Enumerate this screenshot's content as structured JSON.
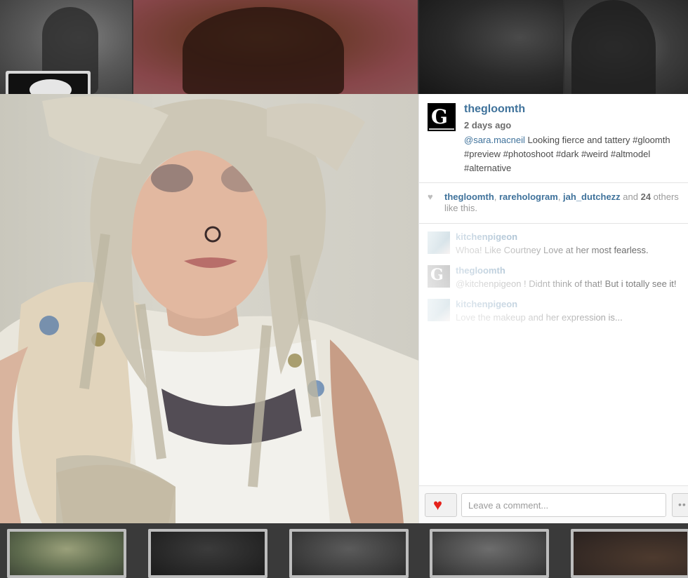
{
  "post": {
    "username": "thegloomth",
    "time_ago": "2 days ago",
    "caption_mention": "@sara.macneil",
    "caption_text": " Looking fierce and tattery #gloomth #preview #photoshoot #dark #weird #altmodel #alternative",
    "likes": {
      "users": [
        "thegloomth",
        "rarehologram",
        "jah_dutchezz"
      ],
      "and_text": " and ",
      "count": "24",
      "others_text": " others like this."
    }
  },
  "comments": [
    {
      "user": "kitchenpigeon",
      "text": "Whoa! Like Courtney Love at her most fearless."
    },
    {
      "user": "thegloomth",
      "text": "@kitchenpigeon ! Didnt think of that! But i totally see it!"
    },
    {
      "user": "kitchenpigeon",
      "text": "Love the makeup and her expression is..."
    }
  ],
  "footer": {
    "comment_placeholder": "Leave a comment...",
    "more_label": "••"
  },
  "icons": {
    "like": "heart-icon",
    "likes_heart": "heart-icon",
    "more": "ellipsis-icon"
  },
  "colors": {
    "link": "#3f729b",
    "heart": "#e5221c"
  }
}
